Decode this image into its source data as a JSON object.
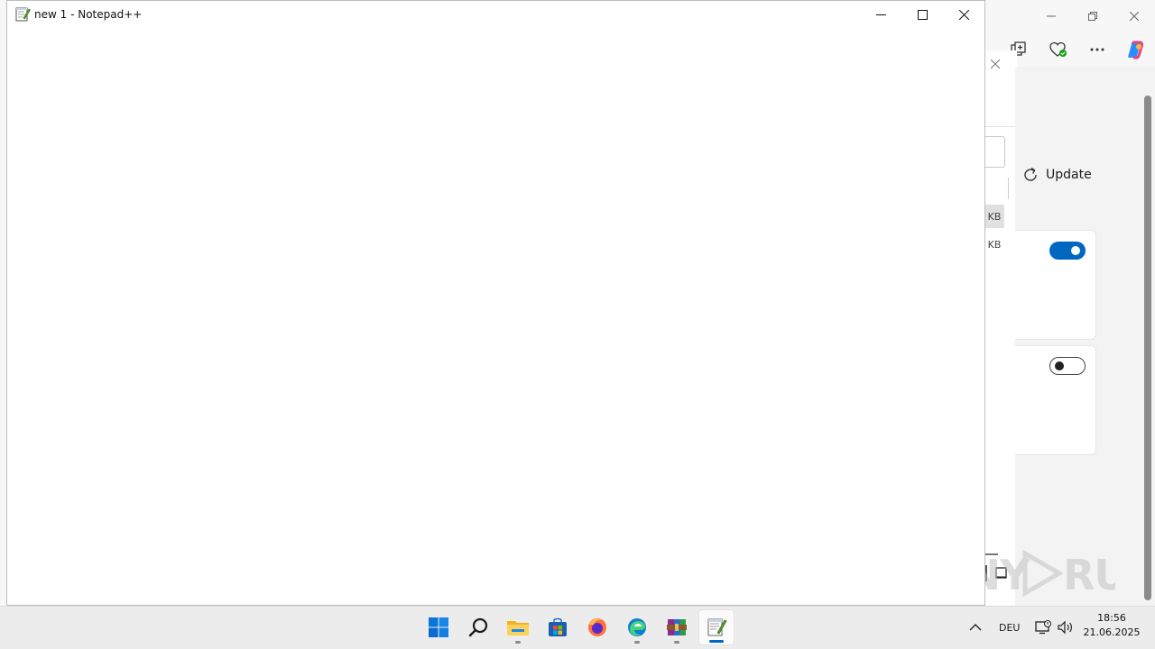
{
  "edge": {
    "panel": {
      "update_label": "Update",
      "size_label_1": "KB",
      "size_label_2": "KB",
      "toggle_1_state": "on",
      "toggle_2_state": "off"
    },
    "watermark_text": "ANY RUN"
  },
  "notepad": {
    "title": "new 1 - Notepad++",
    "content": ""
  },
  "taskbar": {
    "apps": [
      "start-icon",
      "search-icon",
      "file-explorer-icon",
      "store-icon",
      "firefox-icon",
      "edge-icon",
      "winrar-icon",
      "notepadpp-icon"
    ],
    "active_app": "notepadpp-icon",
    "language": "DEU",
    "time": "18:56",
    "date": "21.06.2025"
  },
  "colors": {
    "accent": "#0067c0"
  }
}
